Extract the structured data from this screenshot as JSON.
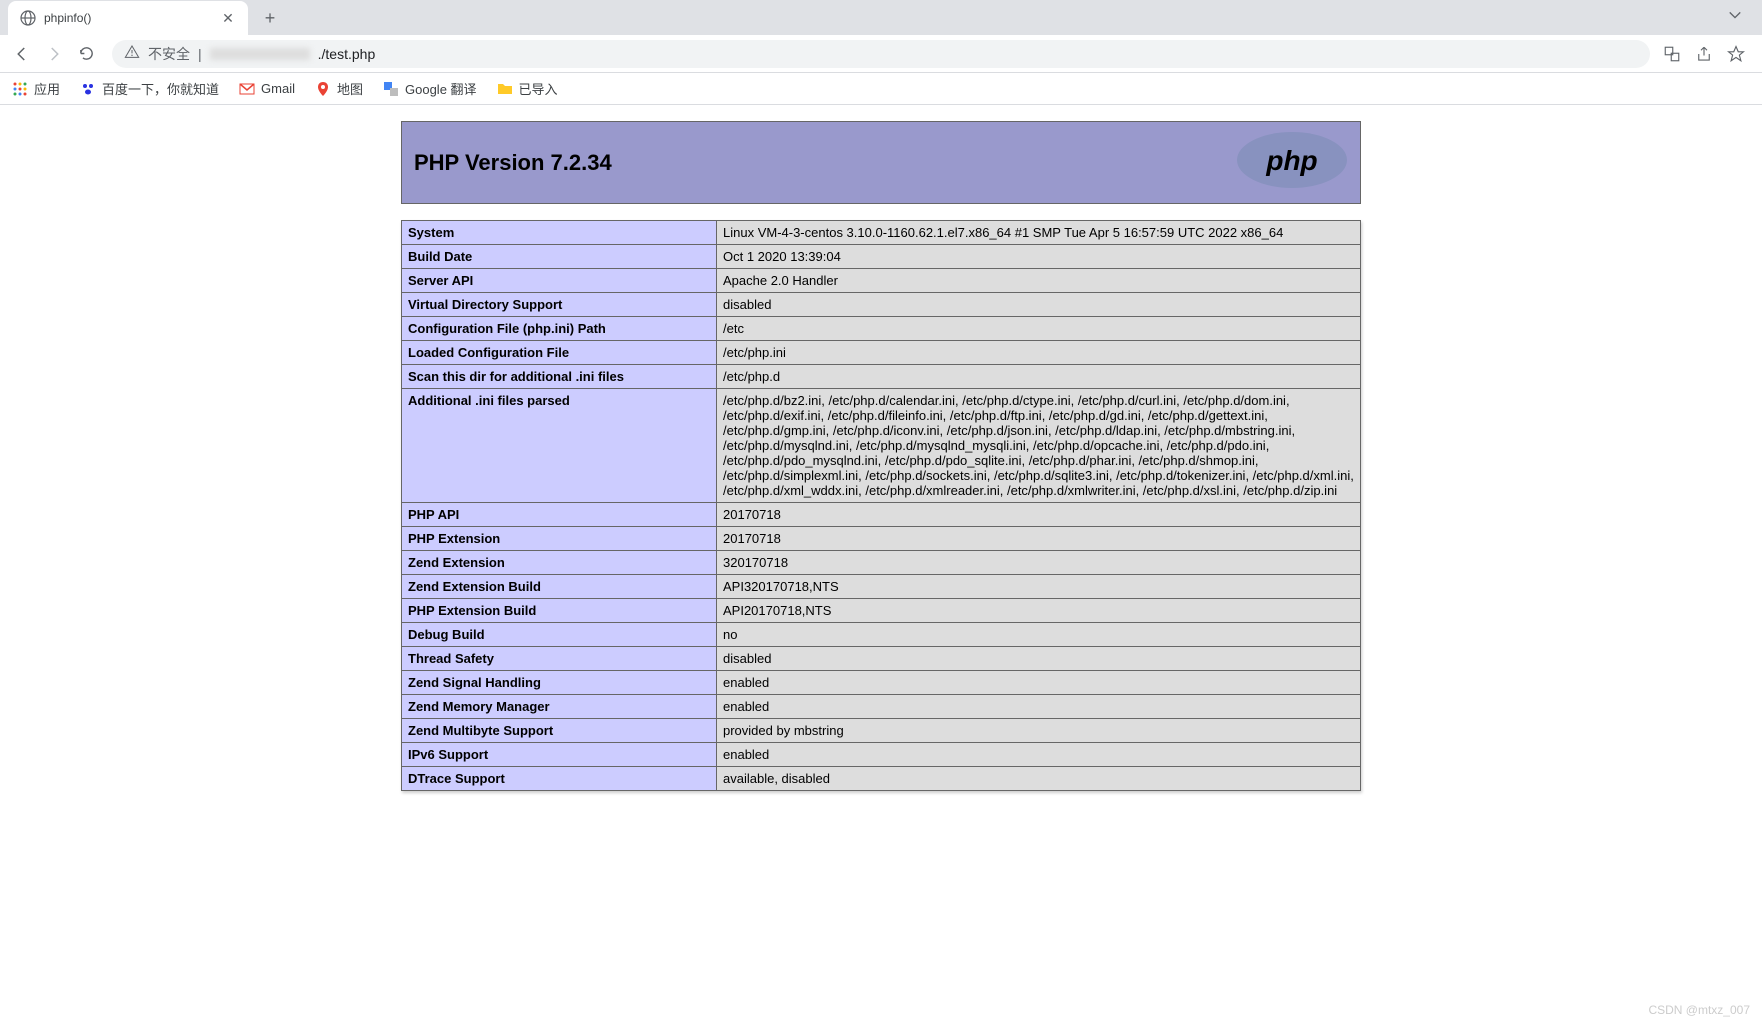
{
  "tab": {
    "title": "phpinfo()"
  },
  "address": {
    "warning": "不安全",
    "url_suffix": "./test.php"
  },
  "bookmarks": {
    "apps": "应用",
    "items": [
      "百度一下，你就知道",
      "Gmail",
      "地图",
      "Google 翻译",
      "已导入"
    ]
  },
  "phpinfo": {
    "header_title": "PHP Version 7.2.34",
    "rows": [
      {
        "label": "System",
        "value": "Linux VM-4-3-centos 3.10.0-1160.62.1.el7.x86_64 #1 SMP Tue Apr 5 16:57:59 UTC 2022 x86_64"
      },
      {
        "label": "Build Date",
        "value": "Oct 1 2020 13:39:04"
      },
      {
        "label": "Server API",
        "value": "Apache 2.0 Handler"
      },
      {
        "label": "Virtual Directory Support",
        "value": "disabled"
      },
      {
        "label": "Configuration File (php.ini) Path",
        "value": "/etc"
      },
      {
        "label": "Loaded Configuration File",
        "value": "/etc/php.ini"
      },
      {
        "label": "Scan this dir for additional .ini files",
        "value": "/etc/php.d"
      },
      {
        "label": "Additional .ini files parsed",
        "value": "/etc/php.d/bz2.ini, /etc/php.d/calendar.ini, /etc/php.d/ctype.ini, /etc/php.d/curl.ini, /etc/php.d/dom.ini, /etc/php.d/exif.ini, /etc/php.d/fileinfo.ini, /etc/php.d/ftp.ini, /etc/php.d/gd.ini, /etc/php.d/gettext.ini, /etc/php.d/gmp.ini, /etc/php.d/iconv.ini, /etc/php.d/json.ini, /etc/php.d/ldap.ini, /etc/php.d/mbstring.ini, /etc/php.d/mysqlnd.ini, /etc/php.d/mysqlnd_mysqli.ini, /etc/php.d/opcache.ini, /etc/php.d/pdo.ini, /etc/php.d/pdo_mysqlnd.ini, /etc/php.d/pdo_sqlite.ini, /etc/php.d/phar.ini, /etc/php.d/shmop.ini, /etc/php.d/simplexml.ini, /etc/php.d/sockets.ini, /etc/php.d/sqlite3.ini, /etc/php.d/tokenizer.ini, /etc/php.d/xml.ini, /etc/php.d/xml_wddx.ini, /etc/php.d/xmlreader.ini, /etc/php.d/xmlwriter.ini, /etc/php.d/xsl.ini, /etc/php.d/zip.ini"
      },
      {
        "label": "PHP API",
        "value": "20170718"
      },
      {
        "label": "PHP Extension",
        "value": "20170718"
      },
      {
        "label": "Zend Extension",
        "value": "320170718"
      },
      {
        "label": "Zend Extension Build",
        "value": "API320170718,NTS"
      },
      {
        "label": "PHP Extension Build",
        "value": "API20170718,NTS"
      },
      {
        "label": "Debug Build",
        "value": "no"
      },
      {
        "label": "Thread Safety",
        "value": "disabled"
      },
      {
        "label": "Zend Signal Handling",
        "value": "enabled"
      },
      {
        "label": "Zend Memory Manager",
        "value": "enabled"
      },
      {
        "label": "Zend Multibyte Support",
        "value": "provided by mbstring"
      },
      {
        "label": "IPv6 Support",
        "value": "enabled"
      },
      {
        "label": "DTrace Support",
        "value": "available, disabled"
      }
    ]
  },
  "watermark": "CSDN @mtxz_007"
}
